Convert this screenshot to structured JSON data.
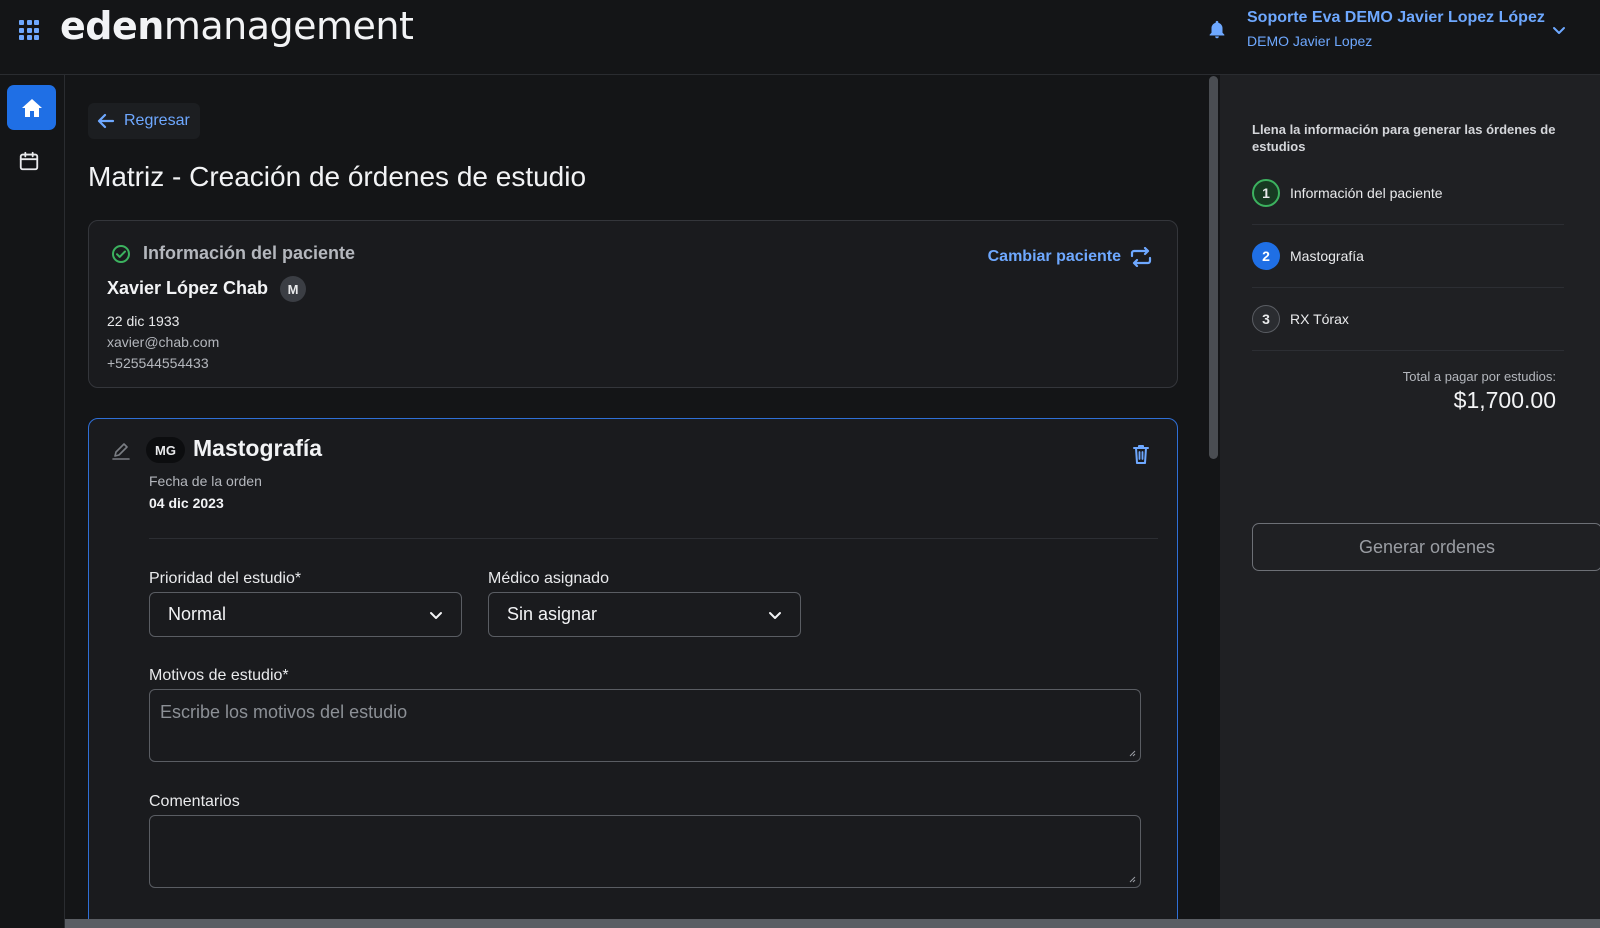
{
  "app": {
    "logo_bold": "eden",
    "logo_light": "management"
  },
  "user": {
    "name": "Soporte Eva DEMO Javier Lopez López",
    "organization": "DEMO Javier Lopez"
  },
  "nav": {
    "back_label": "Regresar"
  },
  "page": {
    "title": "Matriz - Creación de órdenes de estudio"
  },
  "patient": {
    "section_title": "Información del paciente",
    "name": "Xavier López Chab",
    "gender_badge": "M",
    "birth_date": "22 dic 1933",
    "email": "xavier@chab.com",
    "phone": "+525544554433",
    "change_label": "Cambiar paciente"
  },
  "study": {
    "badge": "MG",
    "title": "Mastografía",
    "order_date_label": "Fecha de la orden",
    "order_date": "04 dic 2023",
    "priority_label": "Prioridad del estudio*",
    "priority_value": "Normal",
    "doctor_label": "Médico asignado",
    "doctor_value": "Sin asignar",
    "reasons_label": "Motivos de estudio*",
    "reasons_placeholder": "Escribe los motivos del estudio",
    "comments_label": "Comentarios"
  },
  "summary": {
    "intro": "Llena la información para generar las órdenes de estudios",
    "steps": [
      {
        "number": "1",
        "label": "Información del paciente",
        "state": "done"
      },
      {
        "number": "2",
        "label": "Mastografía",
        "state": "active"
      },
      {
        "number": "3",
        "label": "RX Tórax",
        "state": "pending"
      }
    ],
    "total_label": "Total a pagar por estudios:",
    "total_value": "$1,700.00",
    "generate_label": "Generar ordenes"
  },
  "colors": {
    "accent": "#6ea8ff",
    "primary": "#1f6fe5",
    "success": "#3cb25f",
    "background": "#141517",
    "panel": "#1f2023"
  }
}
